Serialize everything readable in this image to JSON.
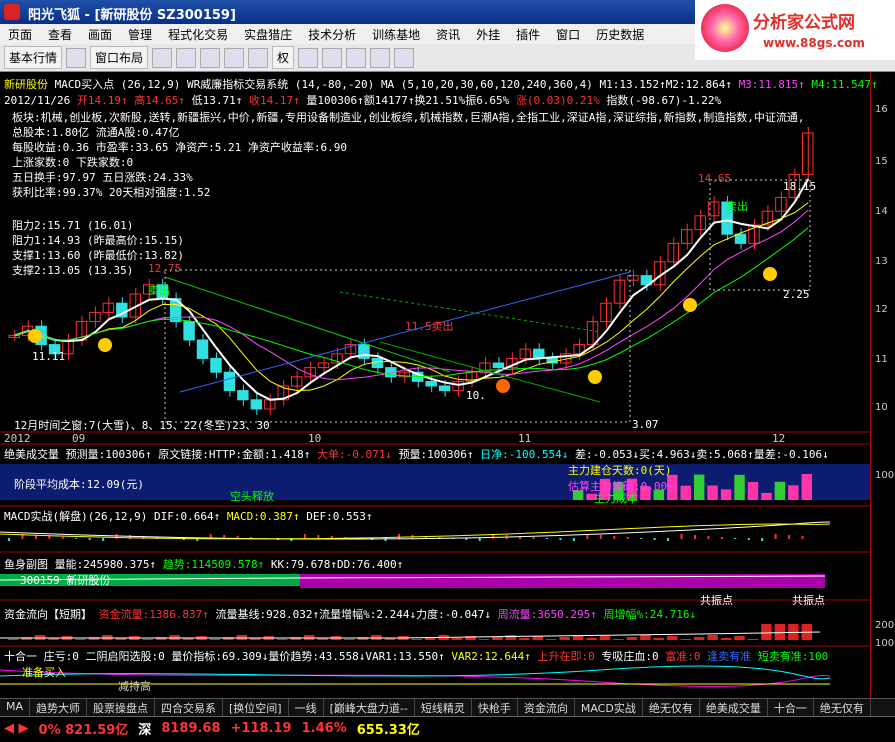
{
  "window": {
    "title": "阳光飞狐 - [新研股份 SZ300159]"
  },
  "brand": {
    "line1": "分析家公式网",
    "line2": "www.88gs.com"
  },
  "menu": [
    "页面",
    "查看",
    "画面",
    "管理",
    "程式化交易",
    "实盘猎庄",
    "技术分析",
    "训练基地",
    "资讯",
    "外挂",
    "插件",
    "窗口",
    "历史数据"
  ],
  "toolbar": {
    "item1": "基本行情",
    "item2": "窗口布局",
    "item3": "权"
  },
  "header": {
    "row1_name": "新研股份",
    "row1_ind": "MACD买入点 (26,12,9)",
    "row1_ind2": "WR威廉指标交易系统 (14,-80,-20)",
    "row1_ma": "MA (5,10,20,30,60,120,240,360,4)",
    "row1_m1": "M1:13.152↑M2:12.864↑",
    "row1_m3": "M3:11.815↑",
    "row1_m4": "M4:11.547↑",
    "row2_date": "2012/11/26",
    "row2_open": "开14.19↑",
    "row2_high": "高14.65↑",
    "row2_low": "低13.71↑",
    "row2_close": "收14.17↑",
    "row2_vol": "量100306↑额14177↑换21.51%振6.65%",
    "row2_chg": "涨(0.03)0.21%",
    "row2_idx": "指数(-98.67)-1.22%"
  },
  "fundamentals": [
    "板块:机械,创业板,次新股,送转,新疆振兴,中价,新疆,专用设备制造业,创业板综,机械指数,巨潮A指,全指工业,深证A指,深证综指,新指数,制造指数,中证流通,",
    "总股本:1.80亿  流通A股:0.47亿",
    "每股收益:0.36 市盈率:33.65 净资产:5.21 净资产收益率:6.90",
    "上涨家数:0 下跌家数:0",
    "五日换手:97.97 五日涨跌:24.33%",
    "获利比率:99.37% 20天相对强度:1.52"
  ],
  "levels": [
    "阻力2:15.71 (16.01)",
    "阻力1:14.93 (昨最高价:15.15)",
    "支撑1:13.60 (昨最低价:13.82)",
    "支撑2:13.05 (13.35)"
  ],
  "annotations": {
    "p1275": "12.75",
    "p1111": "11.11",
    "p1465": "14.65",
    "p1815": "18.15",
    "p1150": "11.5卖出",
    "p1010": "10.",
    "p307": "3.07",
    "p225": "2.25",
    "sell1": "卖出",
    "sell2": "卖出",
    "window": "12月时间之窗:7(大雪)、8、15、22(冬至)23、30"
  },
  "xaxis": [
    "2012",
    "09",
    "10",
    "11",
    "12"
  ],
  "yaxis": [
    "16",
    "15",
    "14",
    "13",
    "12",
    "11",
    "10"
  ],
  "subright": [
    "1000",
    "2000",
    "1000"
  ],
  "panels": {
    "p1": "绝美成交量  预测量:100306↑  原文链接:HTTP:金额:1.418↑",
    "p1b": "大单:-0.071↓",
    "p1c": "预量:100306↑",
    "p1d": "日净:-100.554↓",
    "p1e": "差:-0.053↓买:4.963↓卖:5.068↑量差:-0.106↓",
    "p1f": "主力建仓天数:0(天)",
    "p1g": "估算主力筹码:0.00%",
    "p1h": "阶段平均成本:12.09(元)",
    "p1i": "主力成本",
    "p1j": "空头释放",
    "p2": "MACD实战(解盘)(26,12,9) DIF:0.664↑",
    "p2b": "MACD:0.387↑",
    "p2c": "DEF:0.553↑",
    "p3": "鱼身副图 量能:245980.375↑",
    "p3b": "趋势:114509.578↑",
    "p3c": "KK:79.678↑DD:76.400↑",
    "p3d": "300159 新研股份",
    "p3e": "共振点",
    "p3f": "共振点",
    "p4": "资金流向【短期】",
    "p4b": "资金流量:1386.837↑",
    "p4c": "流量基线:928.032↑流量增幅%:2.244↓力度:-0.047↓",
    "p4d": "周流量:3650.295↑",
    "p4e": "周增幅%:24.716↓",
    "p5": "十合一 庄亏:0 二阴启阳选股:0 量价指标:69.309↓量价趋势:43.558↓VAR1:13.550↑",
    "p5b": "VAR2:12.644↑",
    "p5c": "上升在即:0",
    "p5d": "专吸庄血:0",
    "p5e": "富准:0",
    "p5f": "逢卖有准",
    "p5g": "短卖有准:100",
    "p5h": "准备买入",
    "p5i": "减持高"
  },
  "tabs": [
    "MA",
    "趋势大师",
    "股票操盘点",
    "四合交易系",
    "[换位空间]",
    "一线",
    "[巅峰大盘力道--",
    "短线精灵",
    "快枪手",
    "资金流向",
    "MACD实战",
    "绝无仅有",
    "绝美成交量",
    "十合一",
    "绝无仅有"
  ],
  "status": {
    "s1": "0% 821.59亿",
    "s2": "深",
    "s3": "8189.68",
    "s4": "+118.19",
    "s5": "1.46%",
    "s6": "655.33亿"
  },
  "colors": {
    "up": "#ff3030",
    "down": "#30e0e0",
    "yellow": "#ffff00",
    "magenta": "#ff40ff",
    "green": "#00e000"
  },
  "candles": [
    11.6,
    11.8,
    11.4,
    11.2,
    11.5,
    11.9,
    12.1,
    12.3,
    12.0,
    12.5,
    12.7,
    12.4,
    11.9,
    11.5,
    11.1,
    10.8,
    10.4,
    10.2,
    10.0,
    10.2,
    10.5,
    10.7,
    10.9,
    11.0,
    11.2,
    11.4,
    11.1,
    10.9,
    10.7,
    10.8,
    10.6,
    10.5,
    10.4,
    10.6,
    10.8,
    11.0,
    10.9,
    11.1,
    11.3,
    11.1,
    11.0,
    11.2,
    11.4,
    11.9,
    12.3,
    12.8,
    12.9,
    12.7,
    13.2,
    13.6,
    13.9,
    14.2,
    14.5,
    13.8,
    13.6,
    14.0,
    14.3,
    14.6,
    15.1,
    16.0
  ]
}
